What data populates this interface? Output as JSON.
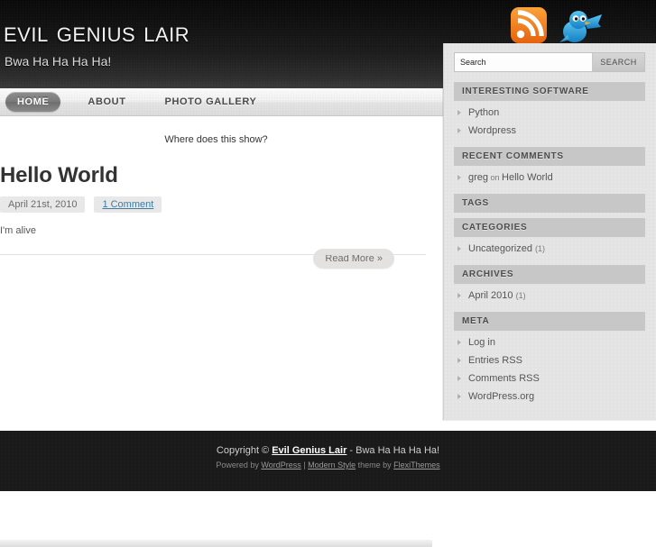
{
  "header": {
    "site_title": "Evil Genius Lair",
    "site_description": "Bwa Ha Ha Ha Ha!",
    "social": [
      {
        "name": "rss-icon",
        "label": "RSS",
        "color": "#f0761d"
      },
      {
        "name": "twitter-icon",
        "label": "Twitter",
        "color": "#2ba3dd"
      }
    ]
  },
  "nav": {
    "items": [
      {
        "label": "Home",
        "active": true
      },
      {
        "label": "About",
        "active": false
      },
      {
        "label": "Photo Gallery",
        "active": false
      }
    ]
  },
  "content": {
    "stray_text": "Where does this show?",
    "post": {
      "title": "Hello World",
      "date": "April 21st, 2010",
      "comments": "1 Comment",
      "excerpt": "I'm alive",
      "read_more": "Read More »"
    }
  },
  "sidebar": {
    "search": {
      "value": "Search",
      "placeholder": "Search",
      "button_label": "Search"
    },
    "widgets": [
      {
        "title": "Interesting Software",
        "items": [
          {
            "label": "Python"
          },
          {
            "label": "Wordpress"
          }
        ]
      },
      {
        "title": "Recent Comments",
        "items": [
          {
            "label": "greg",
            "connector": " on ",
            "target": "Hello World"
          }
        ]
      },
      {
        "title": "Tags",
        "items": []
      },
      {
        "title": "Categories",
        "items": [
          {
            "label": "Uncategorized",
            "count": "(1)"
          }
        ]
      },
      {
        "title": "Archives",
        "items": [
          {
            "label": "April 2010",
            "count": "(1)"
          }
        ]
      },
      {
        "title": "Meta",
        "items": [
          {
            "label": "Log in"
          },
          {
            "label": "Entries RSS"
          },
          {
            "label": "Comments RSS"
          },
          {
            "label": "WordPress.org"
          }
        ]
      }
    ]
  },
  "footer": {
    "copyright_prefix": "Copyright © ",
    "site_name": "Evil Genius Lair",
    "copyright_suffix": " - Bwa Ha Ha Ha Ha!",
    "credits_powered": "Powered by ",
    "credits_wordpress": "WordPress",
    "credits_divider": " | ",
    "credits_theme": "Modern Style",
    "credits_themeby": " theme by ",
    "credits_author": "FlexiThemes"
  },
  "colors": {
    "header_dark": "#0a0a0a",
    "accent_link": "#3a7ca5",
    "sidebar_bg": "#e3e3e3",
    "widget_title_bg": "#c7c7c7",
    "footer_bg": "#1a1a1a",
    "rss_orange": "#f0761d",
    "twitter_blue": "#2ba3dd"
  }
}
